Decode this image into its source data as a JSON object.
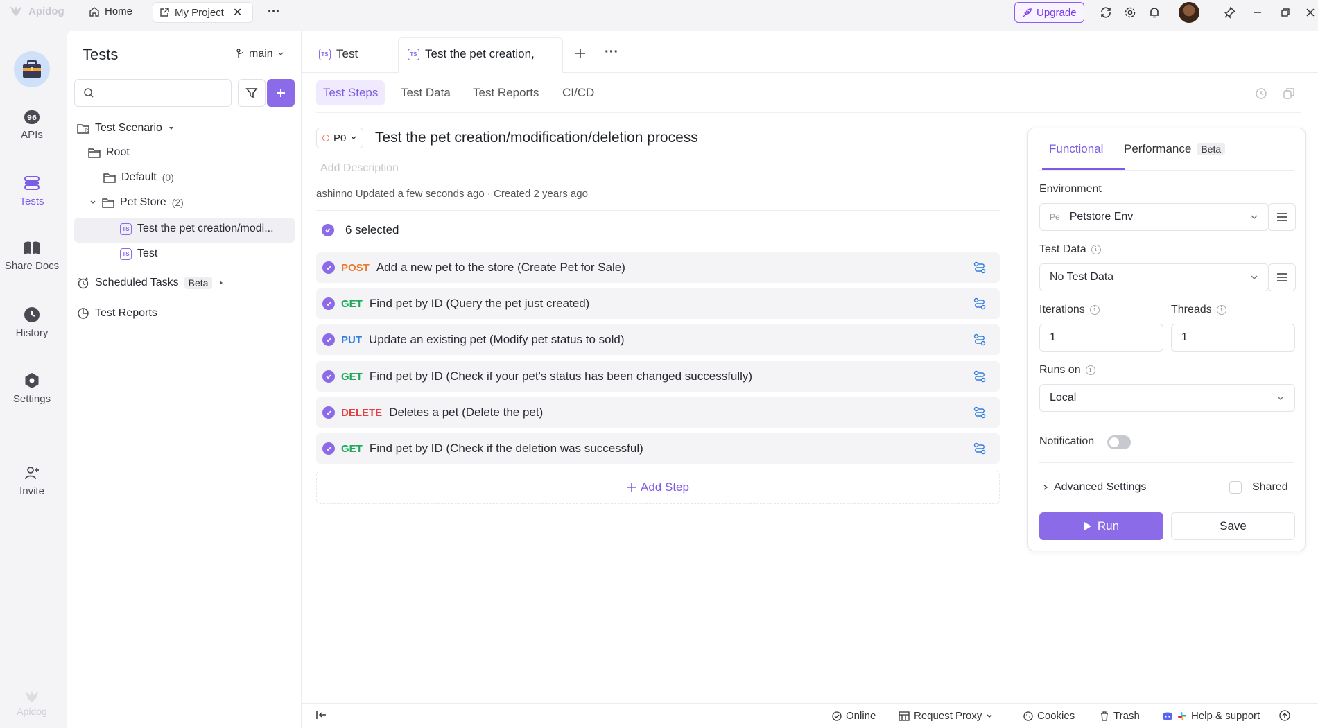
{
  "titlebar": {
    "app_name": "Apidog",
    "home_label": "Home",
    "project_tab": "My Project",
    "upgrade_label": "Upgrade"
  },
  "rail": {
    "items": [
      {
        "label": "APIs"
      },
      {
        "label": "Tests"
      },
      {
        "label": "Share Docs"
      },
      {
        "label": "History"
      },
      {
        "label": "Settings"
      },
      {
        "label": "Invite"
      }
    ],
    "footer_logo": "Apidog"
  },
  "tree": {
    "title": "Tests",
    "branch": "main",
    "search_placeholder": "",
    "scenario_label": "Test Scenario",
    "root_label": "Root",
    "default_label": "Default",
    "default_count": "(0)",
    "petstore_label": "Pet Store",
    "petstore_count": "(2)",
    "item1": "Test the pet creation/modi...",
    "item2": "Test",
    "scheduled_label": "Scheduled Tasks",
    "beta_label": "Beta",
    "reports_label": "Test Reports"
  },
  "main": {
    "tabs": [
      {
        "label": "Test"
      },
      {
        "label": "Test the pet creation,"
      }
    ],
    "subtabs": [
      {
        "label": "Test Steps"
      },
      {
        "label": "Test Data"
      },
      {
        "label": "Test Reports"
      },
      {
        "label": "CI/CD"
      }
    ],
    "priority": "P0",
    "title": "Test the pet creation/modification/deletion process",
    "description_placeholder": "Add Description",
    "meta": "ashinno Updated a few seconds ago · Created 2 years ago",
    "selected_label": "6 selected",
    "steps": [
      {
        "method": "POST",
        "text": "Add a new pet to the store (Create Pet for Sale)"
      },
      {
        "method": "GET",
        "text": "Find pet by ID (Query the pet just created)"
      },
      {
        "method": "PUT",
        "text": "Update an existing pet (Modify pet status to sold)"
      },
      {
        "method": "GET",
        "text": "Find pet by ID (Check if your pet's status has been changed successfully)"
      },
      {
        "method": "DELETE",
        "text": "Deletes a pet (Delete the pet)"
      },
      {
        "method": "GET",
        "text": "Find pet by ID (Check if the deletion was successful)"
      }
    ],
    "add_step_label": "Add Step"
  },
  "runpanel": {
    "tab_functional": "Functional",
    "tab_performance": "Performance",
    "beta_label": "Beta",
    "environment_label": "Environment",
    "env_prefix": "Pe",
    "env_value": "Petstore Env",
    "testdata_label": "Test Data",
    "testdata_value": "No Test Data",
    "iterations_label": "Iterations",
    "iterations_value": "1",
    "threads_label": "Threads",
    "threads_value": "1",
    "runson_label": "Runs on",
    "runson_value": "Local",
    "notification_label": "Notification",
    "advanced_label": "Advanced Settings",
    "shared_label": "Shared",
    "run_label": "Run",
    "save_label": "Save"
  },
  "footer": {
    "online": "Online",
    "proxy": "Request Proxy",
    "cookies": "Cookies",
    "trash": "Trash",
    "help": "Help & support"
  },
  "colors": {
    "accent": "#8b6be8",
    "post": "#ea7a30",
    "get": "#1fa85a",
    "put": "#2f7de1",
    "delete": "#e53e3e"
  }
}
